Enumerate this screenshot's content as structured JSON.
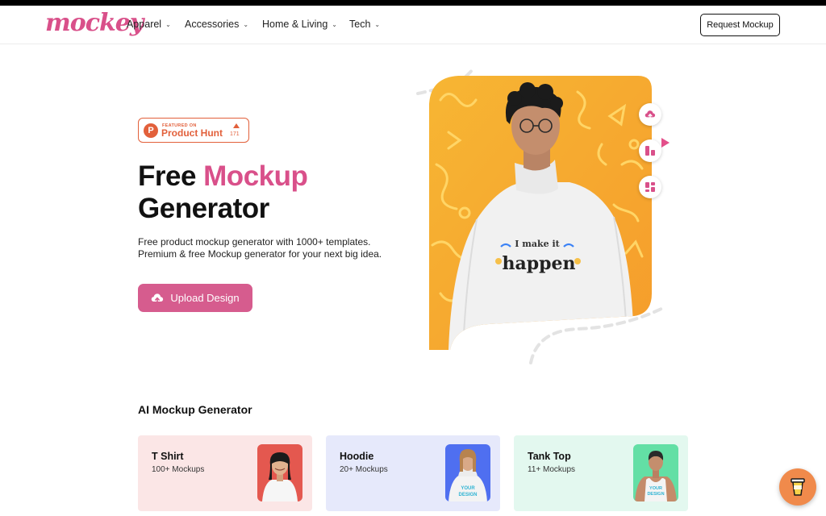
{
  "brand": {
    "logo_text": "mockey",
    "accent_color": "#d9508a"
  },
  "nav": {
    "items": [
      {
        "label": "Apparel"
      },
      {
        "label": "Accessories"
      },
      {
        "label": "Home & Living"
      },
      {
        "label": "Tech"
      }
    ],
    "request_button": "Request Mockup"
  },
  "product_hunt": {
    "featured_label": "FEATURED ON",
    "name": "Product Hunt",
    "upvotes": "171"
  },
  "hero": {
    "title_part1": "Free ",
    "title_accent": "Mockup",
    "title_part2": "Generator",
    "description": "Free product mockup generator with 1000+ templates. Premium & free Mockup generator for your next big idea.",
    "upload_button": "Upload Design",
    "shirt_text_line1": "I make it",
    "shirt_text_line2": "happen"
  },
  "section": {
    "title": "AI Mockup Generator"
  },
  "cards": [
    {
      "title": "T Shirt",
      "count": "100+ Mockups",
      "bg": "#fbe6e6"
    },
    {
      "title": "Hoodie",
      "count": "20+ Mockups",
      "bg": "#e6e9fb"
    },
    {
      "title": "Tank Top",
      "count": "11+ Mockups",
      "bg": "#e3f8ef"
    }
  ],
  "card_thumbs": [
    {
      "shirt_text": ""
    },
    {
      "shirt_text_line1": "YOUR",
      "shirt_text_line2": "DESIGN"
    },
    {
      "shirt_text_line1": "YOUR",
      "shirt_text_line2": "DESIGN"
    }
  ],
  "icons": {
    "upload": "cloud-upload-icon",
    "coffee": "coffee-cup-icon"
  }
}
